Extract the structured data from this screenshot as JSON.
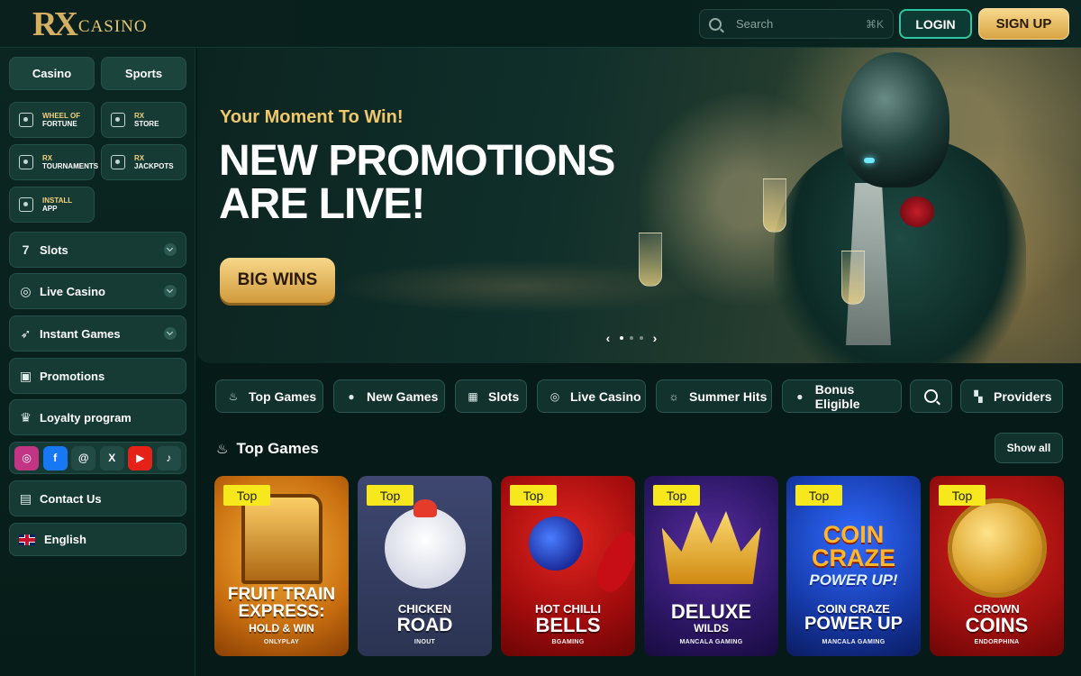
{
  "header": {
    "logo_rx": "RX",
    "logo_casino": "CASINO",
    "search_placeholder": "Search",
    "search_shortcut": "⌘K",
    "login_label": "LOGIN",
    "signup_label": "SIGN UP"
  },
  "sidebar": {
    "tabs": [
      {
        "label": "Casino"
      },
      {
        "label": "Sports"
      }
    ],
    "mini": [
      {
        "line1": "WHEEL OF",
        "line2": "FORTUNE",
        "icon": "wheel-icon"
      },
      {
        "line1": "RX",
        "line2": "STORE",
        "icon": "store-icon"
      },
      {
        "line1": "RX",
        "line2": "TOURNAMENTS",
        "icon": "trophy-icon"
      },
      {
        "line1": "RX",
        "line2": "JACKPOTS",
        "icon": "jackpot-icon"
      },
      {
        "line1": "INSTALL",
        "line2": "APP",
        "icon": "phone-icon"
      }
    ],
    "nav": [
      {
        "label": "Slots",
        "icon": "seven-icon"
      },
      {
        "label": "Live Casino",
        "icon": "chip-icon"
      },
      {
        "label": "Instant Games",
        "icon": "rocket-icon"
      },
      {
        "label": "Promotions",
        "icon": "promo-icon"
      },
      {
        "label": "Loyalty program",
        "icon": "crown-icon"
      }
    ],
    "social": [
      "instagram",
      "facebook",
      "threads",
      "x",
      "youtube",
      "tiktok"
    ],
    "contact_label": "Contact Us",
    "language_label": "English"
  },
  "banner": {
    "kicker": "Your Moment To Win!",
    "title_line1": "NEW PROMOTIONS",
    "title_line2": "ARE LIVE!",
    "cta": "BIG WINS"
  },
  "categories": [
    {
      "label": "Top Games",
      "icon": "flame-icon"
    },
    {
      "label": "New Games",
      "icon": "new-icon"
    },
    {
      "label": "Slots",
      "icon": "slots-icon"
    },
    {
      "label": "Live Casino",
      "icon": "chip-icon"
    },
    {
      "label": "Summer Hits",
      "icon": "sun-icon"
    },
    {
      "label": "Bonus Eligible",
      "icon": "bonus-icon"
    },
    {
      "label": "Providers",
      "icon": "grid-icon"
    }
  ],
  "section": {
    "title": "Top Games",
    "show_all": "Show all"
  },
  "games": [
    {
      "badge": "Top",
      "name_a": "FRUIT TRAIN",
      "name_b": "EXPRESS:",
      "name_c": "HOLD & WIN",
      "provider": "ONLYPLAY"
    },
    {
      "badge": "Top",
      "name_a": "CHICKEN",
      "name_b": "ROAD",
      "name_c": "",
      "provider": "INOUT"
    },
    {
      "badge": "Top",
      "name_a": "HOT CHILLI",
      "name_b": "BELLS",
      "name_c": "",
      "provider": "BGAMING"
    },
    {
      "badge": "Top",
      "name_a": "DELUXE",
      "name_b": "WILDS",
      "name_c": "",
      "provider": "MANCALA GAMING"
    },
    {
      "badge": "Top",
      "name_a": "COIN CRAZE",
      "name_b": "POWER UP",
      "name_c": "",
      "provider": "MANCALA GAMING",
      "art_a": "COIN",
      "art_b": "CRAZE",
      "art_c": "POWER UP!"
    },
    {
      "badge": "Top",
      "name_a": "CROWN",
      "name_b": "COINS",
      "name_c": "",
      "provider": "ENDORPHINA"
    }
  ]
}
